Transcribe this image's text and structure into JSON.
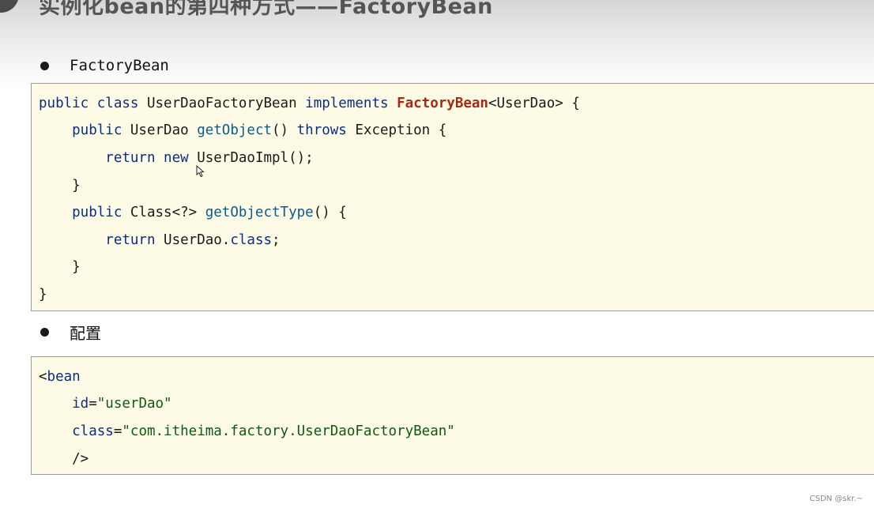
{
  "slide": {
    "title": "实例化bean的第四种方式——FactoryBean"
  },
  "bullets": [
    {
      "text": "FactoryBean"
    },
    {
      "text": "配置"
    }
  ],
  "code_java": {
    "line1": {
      "t1": "public class",
      "t2": " UserDaoFactoryBean ",
      "t3": "implements",
      "t4": " ",
      "t5": "FactoryBean",
      "t6": "<UserDao> {"
    },
    "line2": {
      "t1": "    public",
      "t2": " UserDao ",
      "t3": "getObject",
      "t4": "() ",
      "t5": "throws",
      "t6": " Exception {"
    },
    "line3": {
      "t1": "        return new",
      "t2": " UserDaoImpl();"
    },
    "line4": {
      "t1": "    }"
    },
    "line5": {
      "t1": "    public",
      "t2": " Class<?> ",
      "t3": "getObjectType",
      "t4": "() {"
    },
    "line6": {
      "t1": "        return",
      "t2": " UserDao.",
      "t3": "class",
      "t4": ";"
    },
    "line7": {
      "t1": "    }"
    },
    "line8": {
      "t1": "}"
    }
  },
  "code_xml": {
    "line1": {
      "t1": "<",
      "t2": "bean"
    },
    "line2": {
      "t1": "    id",
      "t2": "=",
      "t3": "\"userDao\""
    },
    "line3": {
      "t1": "    class",
      "t2": "=",
      "t3": "\"com.itheima.factory.UserDaoFactoryBean\""
    },
    "line4": {
      "t1": "    />"
    }
  },
  "watermark": "CSDN @skr.~",
  "colors": {
    "code_background": "#fdfbe6",
    "keyword": "#0b2d83",
    "method": "#0d5b8c",
    "highlight": "#a52a0e",
    "string": "#0e5a12"
  },
  "icons": {
    "cursor": "mouse-pointer-icon",
    "bullet": "bullet-dot-icon"
  }
}
